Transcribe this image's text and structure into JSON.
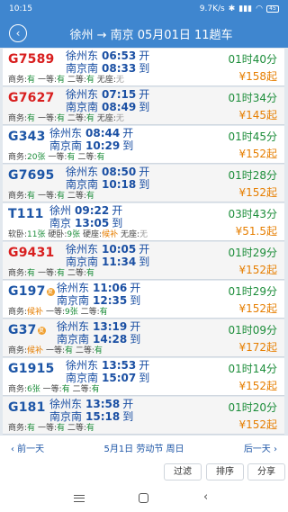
{
  "status": {
    "time": "10:15",
    "speed": "9.7K/s",
    "battery": "45"
  },
  "header": {
    "back_icon": "‹",
    "title": "徐州 → 南京 05月01日 11趟车"
  },
  "trains": [
    {
      "no": "G7589",
      "color": "red",
      "marker": "",
      "from": "徐州东",
      "dep": "06:53",
      "dep_act": "开",
      "to": "南京南",
      "arr": "08:33",
      "arr_act": "到",
      "duration": "01时40分",
      "price": "¥158起",
      "seats": [
        {
          "label": "商务:",
          "value": "有",
          "cls": "ok"
        },
        {
          "label": "一等:",
          "value": "有",
          "cls": "ok"
        },
        {
          "label": "二等:",
          "value": "有",
          "cls": "ok"
        },
        {
          "label": "无座:",
          "value": "无",
          "cls": "none"
        }
      ]
    },
    {
      "no": "G7627",
      "color": "red",
      "marker": "",
      "from": "徐州东",
      "dep": "07:15",
      "dep_act": "开",
      "to": "南京南",
      "arr": "08:49",
      "arr_act": "到",
      "duration": "01时34分",
      "price": "¥145起",
      "seats": [
        {
          "label": "商务:",
          "value": "有",
          "cls": "ok"
        },
        {
          "label": "一等:",
          "value": "有",
          "cls": "ok"
        },
        {
          "label": "二等:",
          "value": "有",
          "cls": "ok"
        },
        {
          "label": "无座:",
          "value": "无",
          "cls": "none"
        }
      ]
    },
    {
      "no": "G343",
      "color": "blue",
      "marker": "",
      "from": "徐州东",
      "dep": "08:44",
      "dep_act": "开",
      "to": "南京南",
      "arr": "10:29",
      "arr_act": "到",
      "duration": "01时45分",
      "price": "¥152起",
      "seats": [
        {
          "label": "商务:",
          "value": "20张",
          "cls": "cnt"
        },
        {
          "label": "一等:",
          "value": "有",
          "cls": "ok"
        },
        {
          "label": "二等:",
          "value": "有",
          "cls": "ok"
        }
      ]
    },
    {
      "no": "G7695",
      "color": "blue",
      "marker": "",
      "from": "徐州东",
      "dep": "08:50",
      "dep_act": "开",
      "to": "南京南",
      "arr": "10:18",
      "arr_act": "到",
      "duration": "01时28分",
      "price": "¥152起",
      "seats": [
        {
          "label": "商务:",
          "value": "有",
          "cls": "ok"
        },
        {
          "label": "一等:",
          "value": "有",
          "cls": "ok"
        },
        {
          "label": "二等:",
          "value": "有",
          "cls": "ok"
        }
      ]
    },
    {
      "no": "T111",
      "color": "blue",
      "marker": "",
      "from": "徐州",
      "dep": "09:22",
      "dep_act": "开",
      "to": "南京",
      "arr": "13:05",
      "arr_act": "到",
      "duration": "03时43分",
      "price": "¥51.5起",
      "seats": [
        {
          "label": "软卧:",
          "value": "11张",
          "cls": "cnt"
        },
        {
          "label": "硬卧:",
          "value": "9张",
          "cls": "cnt"
        },
        {
          "label": "硬座:",
          "value": "候补",
          "cls": "hb"
        },
        {
          "label": "无座:",
          "value": "无",
          "cls": "none"
        }
      ]
    },
    {
      "no": "G9431",
      "color": "red",
      "marker": "",
      "from": "徐州东",
      "dep": "10:05",
      "dep_act": "开",
      "to": "南京南",
      "arr": "11:34",
      "arr_act": "到",
      "duration": "01时29分",
      "price": "¥152起",
      "seats": [
        {
          "label": "商务:",
          "value": "有",
          "cls": "ok"
        },
        {
          "label": "一等:",
          "value": "有",
          "cls": "ok"
        },
        {
          "label": "二等:",
          "value": "有",
          "cls": "ok"
        }
      ]
    },
    {
      "no": "G197",
      "color": "blue",
      "marker": "复",
      "from": "徐州东",
      "dep": "11:06",
      "dep_act": "开",
      "to": "南京南",
      "arr": "12:35",
      "arr_act": "到",
      "duration": "01时29分",
      "price": "¥152起",
      "seats": [
        {
          "label": "商务:",
          "value": "候补",
          "cls": "hb"
        },
        {
          "label": "一等:",
          "value": "9张",
          "cls": "cnt"
        },
        {
          "label": "二等:",
          "value": "有",
          "cls": "ok"
        }
      ]
    },
    {
      "no": "G37",
      "color": "blue",
      "marker": "复",
      "from": "徐州东",
      "dep": "13:19",
      "dep_act": "开",
      "to": "南京南",
      "arr": "14:28",
      "arr_act": "到",
      "duration": "01时09分",
      "price": "¥172起",
      "seats": [
        {
          "label": "商务:",
          "value": "候补",
          "cls": "hb"
        },
        {
          "label": "一等:",
          "value": "有",
          "cls": "ok"
        },
        {
          "label": "二等:",
          "value": "有",
          "cls": "ok"
        }
      ]
    },
    {
      "no": "G1915",
      "color": "blue",
      "marker": "",
      "from": "徐州东",
      "dep": "13:53",
      "dep_act": "开",
      "to": "南京南",
      "arr": "15:07",
      "arr_act": "到",
      "duration": "01时14分",
      "price": "¥152起",
      "seats": [
        {
          "label": "商务:",
          "value": "6张",
          "cls": "cnt"
        },
        {
          "label": "一等:",
          "value": "有",
          "cls": "ok"
        },
        {
          "label": "二等:",
          "value": "有",
          "cls": "ok"
        }
      ]
    },
    {
      "no": "G181",
      "color": "blue",
      "marker": "",
      "from": "徐州东",
      "dep": "13:58",
      "dep_act": "开",
      "to": "南京南",
      "arr": "15:18",
      "arr_act": "到",
      "duration": "01时20分",
      "price": "¥152起",
      "seats": [
        {
          "label": "商务:",
          "value": "有",
          "cls": "ok"
        },
        {
          "label": "一等:",
          "value": "有",
          "cls": "ok"
        },
        {
          "label": "二等:",
          "value": "有",
          "cls": "ok"
        }
      ]
    }
  ],
  "datebar": {
    "prev": "‹ 前一天",
    "current": "5月1日 劳动节 周日",
    "next": "后一天 ›"
  },
  "actions": {
    "filter": "过滤",
    "sort": "排序",
    "share": "分享"
  }
}
